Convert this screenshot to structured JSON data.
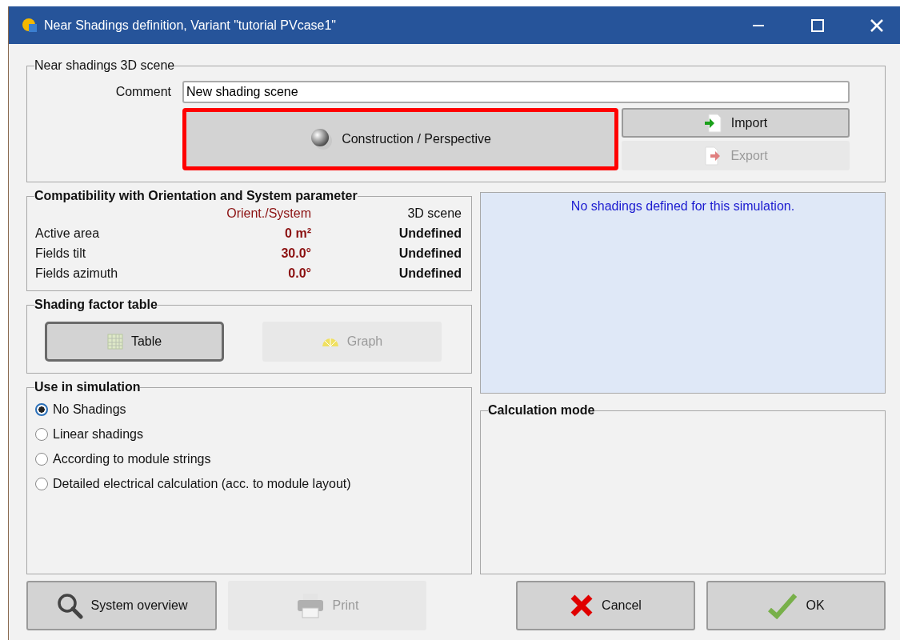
{
  "window": {
    "title": "Near Shadings definition, Variant \"tutorial PVcase1\""
  },
  "scene_group": {
    "title": "Near shadings 3D scene",
    "comment_label": "Comment",
    "comment_value": "New shading scene",
    "construction_button": {
      "label": "Construction / Perspective",
      "highlighted": true,
      "disabled": false
    },
    "import_button": {
      "label": "Import",
      "disabled": false
    },
    "export_button": {
      "label": "Export",
      "disabled": true
    }
  },
  "compatibility": {
    "title": "Compatibility with Orientation and System parameter",
    "columns": [
      "Orient./System",
      "3D scene"
    ],
    "rows": [
      {
        "label": "Active area",
        "system": "0 m²",
        "scene": "Undefined"
      },
      {
        "label": "Fields tilt",
        "system": "30.0°",
        "scene": "Undefined"
      },
      {
        "label": "Fields azimuth",
        "system": "0.0°",
        "scene": "Undefined"
      }
    ]
  },
  "shading_factor_table": {
    "title": "Shading factor table",
    "buttons": [
      {
        "kind": "table",
        "label": "Table",
        "disabled": false
      },
      {
        "kind": "graph",
        "label": "Graph",
        "disabled": true
      }
    ]
  },
  "info_panel": {
    "message": "No shadings defined for this simulation."
  },
  "use_in_simulation": {
    "title": "Use in simulation",
    "options": [
      {
        "label": "No Shadings",
        "selected": true
      },
      {
        "label": "Linear shadings",
        "selected": false
      },
      {
        "label": "According to module strings",
        "selected": false
      },
      {
        "label": "Detailed electrical calculation (acc. to module layout)",
        "selected": false
      }
    ]
  },
  "calculation_mode": {
    "title": "Calculation mode"
  },
  "footer_buttons": [
    {
      "kind": "overview",
      "label": "System overview",
      "disabled": false
    },
    {
      "kind": "print",
      "label": "Print",
      "disabled": true
    },
    {
      "kind": "cancel",
      "label": "Cancel",
      "disabled": false
    },
    {
      "kind": "ok",
      "label": "OK",
      "disabled": false
    }
  ]
}
